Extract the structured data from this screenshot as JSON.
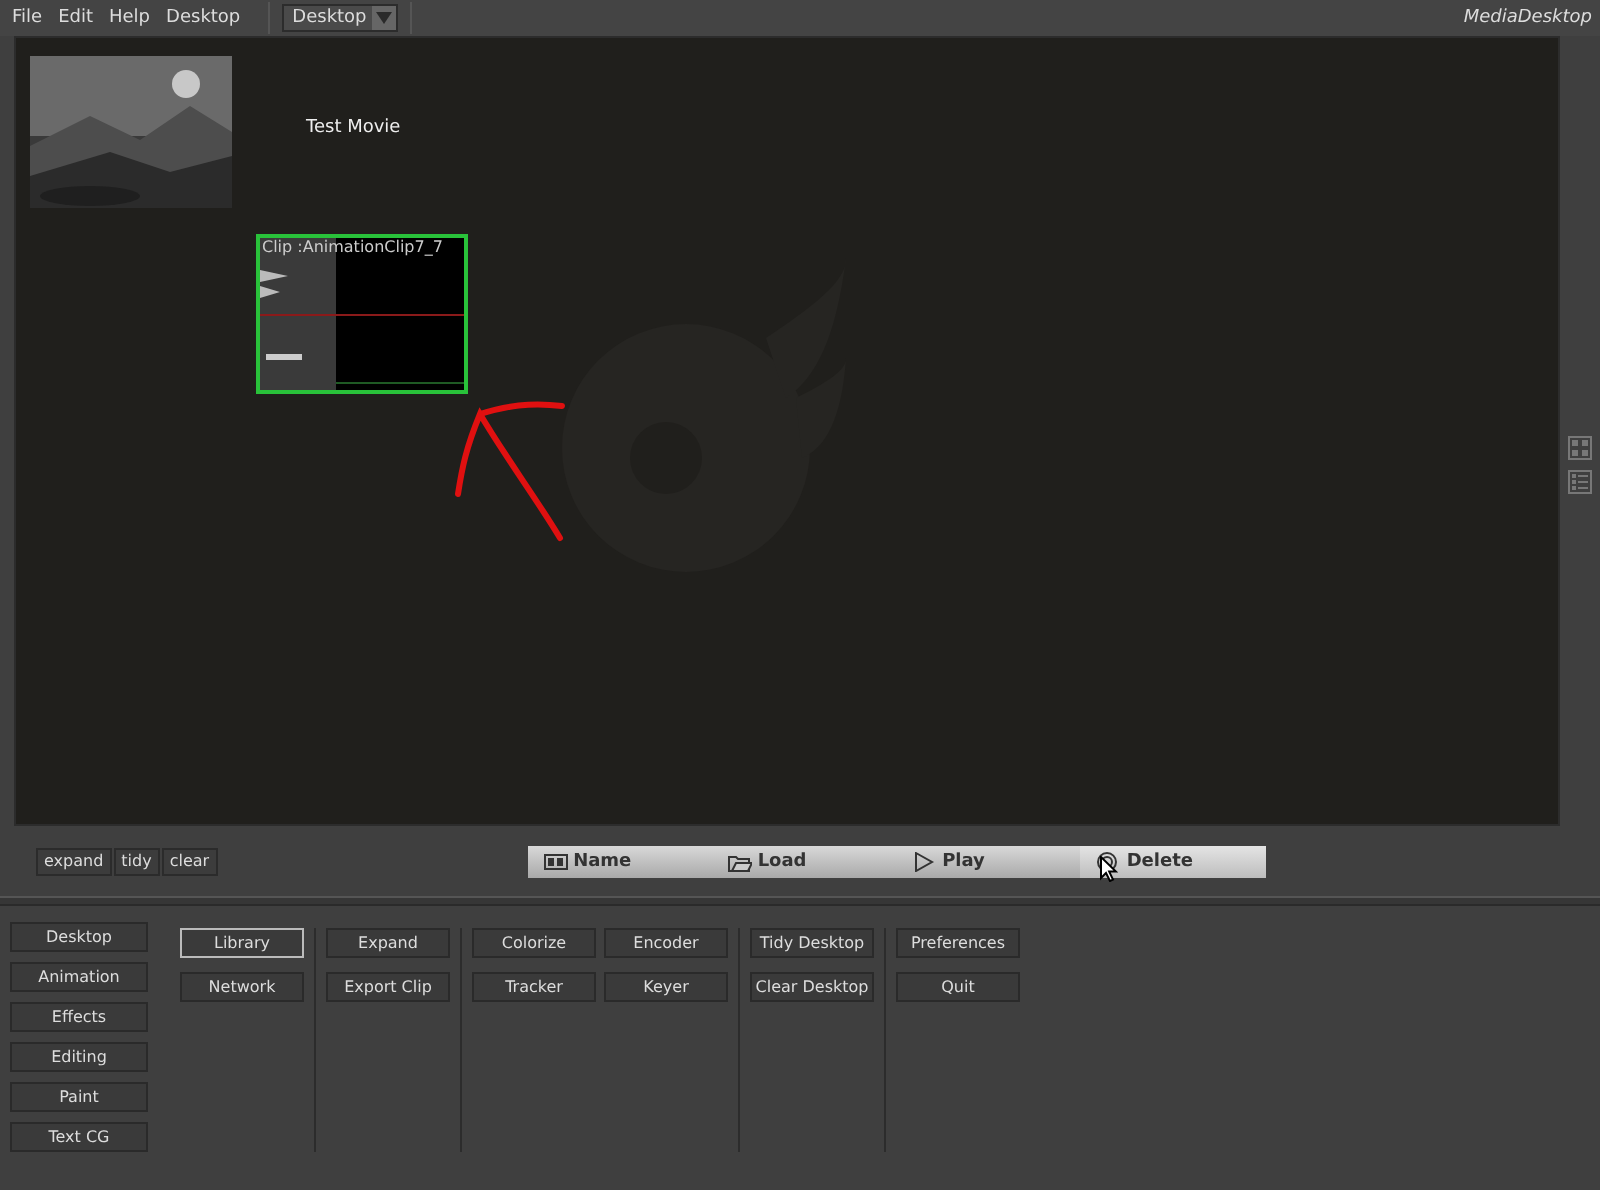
{
  "menu": {
    "items": [
      "File",
      "Edit",
      "Help",
      "Desktop"
    ],
    "desktop_select": {
      "value": "Desktop"
    },
    "app_title": "MediaDesktop"
  },
  "canvas": {
    "items": [
      {
        "kind": "movie",
        "title": "Test Movie"
      },
      {
        "kind": "clip",
        "title": "Clip :AnimationClip7_7",
        "selected": true
      }
    ]
  },
  "desktop_tools": [
    "expand",
    "tidy",
    "clear"
  ],
  "clip_toolbar": [
    {
      "kind": "name",
      "label": "Name"
    },
    {
      "kind": "load",
      "label": "Load"
    },
    {
      "kind": "play",
      "label": "Play"
    },
    {
      "kind": "delete",
      "label": "Delete"
    }
  ],
  "sidebar": {
    "items": [
      "Desktop",
      "Animation",
      "Effects",
      "Editing",
      "Paint",
      "Text CG"
    ]
  },
  "function_groups": [
    {
      "buttons": [
        {
          "label": "Library",
          "selected": true
        },
        {
          "label": "Network",
          "selected": false
        }
      ]
    },
    {
      "buttons": [
        {
          "label": "Expand",
          "selected": false
        },
        {
          "label": "Export Clip",
          "selected": false
        }
      ]
    },
    {
      "buttons": [
        {
          "label": "Colorize",
          "selected": false
        },
        {
          "label": "Tracker",
          "selected": false
        },
        {
          "label": "Encoder",
          "selected": false
        },
        {
          "label": "Keyer",
          "selected": false
        }
      ]
    },
    {
      "buttons": [
        {
          "label": "Tidy Desktop",
          "selected": false
        },
        {
          "label": "Clear Desktop",
          "selected": false
        }
      ]
    },
    {
      "buttons": [
        {
          "label": "Preferences",
          "selected": false
        },
        {
          "label": "Quit",
          "selected": false
        }
      ]
    }
  ]
}
